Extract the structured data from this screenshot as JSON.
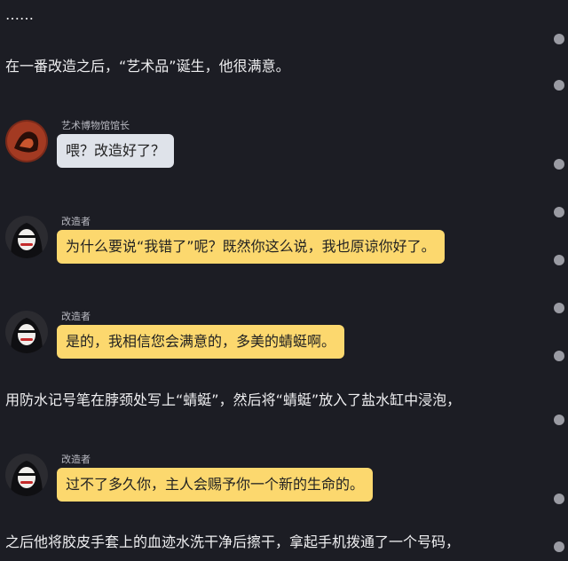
{
  "narration": [
    "……",
    "在一番改造之后，“艺术品”诞生，他很满意。",
    "用防水记号笔在脖颈处写上“蜻蜓”，然后将“蜻蜓”放入了盐水缸中浸泡，",
    "之后他将胶皮手套上的血迹水洗干净后擦干，拿起手机拨通了一个号码，"
  ],
  "messages": [
    {
      "sender": "艺术博物馆馆长",
      "text": "喂？改造好了？",
      "avatar": "museum-curator-avatar",
      "style": "gray"
    },
    {
      "sender": "改造者",
      "text": "为什么要说“我错了”呢？既然你这么说，我也原谅你好了。",
      "avatar": "hooded-figure-avatar",
      "style": "yellow"
    },
    {
      "sender": "改造者",
      "text": "是的，我相信您会满意的，多美的蜻蜓啊。",
      "avatar": "hooded-figure-avatar",
      "style": "yellow"
    },
    {
      "sender": "改造者",
      "text": "过不了多久你，主人会赐予你一个新的生命的。",
      "avatar": "hooded-figure-avatar",
      "style": "yellow"
    }
  ],
  "colors": {
    "background": "#1c1d24",
    "bubble_gray": "#dfe3ea",
    "bubble_yellow": "#fcd86e"
  }
}
